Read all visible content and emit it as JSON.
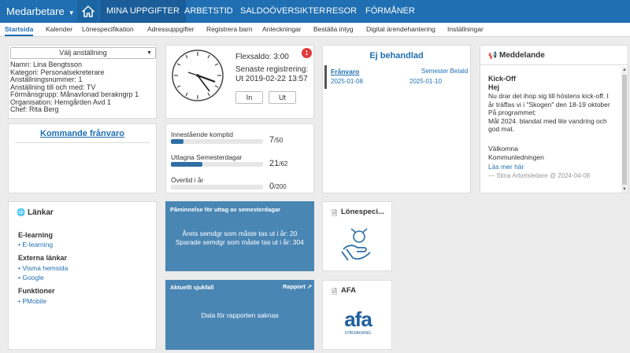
{
  "topbar": {
    "brand": "Medarbetare",
    "nav": [
      "MINA UPPGIFTER",
      "ARBETSTID",
      "SALDOÖVERSIKTER",
      "RESOR",
      "FÖRMÅNER"
    ]
  },
  "subnav": [
    "Startsida",
    "Kalender",
    "Lönespecifikation",
    "Adressuppgifter",
    "Registrera barn",
    "Anteckningar",
    "Beställa intyg",
    "Digital ärendehantering",
    "Inställningar"
  ],
  "employee": {
    "select_label": "Välj anställning",
    "lines": [
      "Namn: Lina Bengtsson",
      "Kategori: Personalsekreterare",
      "Anställningsnummer: 1",
      "Anställning till och med: TV",
      "Förmånsgrupp: Månavlonad berakngrp 1",
      "Organisation: Hemgården Avd 1",
      "Chef: Rita Berg"
    ]
  },
  "clock": {
    "flex": "Flexsaldo: 3:00",
    "last_label": "Senaste registrering:",
    "last_value": "Ut 2019-02-22 13:57",
    "badge": "1",
    "in_label": "In",
    "out_label": "Ut"
  },
  "pending": {
    "title": "Ej behandlad",
    "type": "Frånvaro",
    "status": "Semester Betald",
    "date1": "2025-01-08",
    "date2": "2025-01-10"
  },
  "message": {
    "title": "Meddelande",
    "subject": "Kick-Off",
    "greeting": "Hej",
    "lines": [
      "Nu drar det ihop sig till höstens kick-off. I",
      "år träffas vi i \"Skogen\" den 18-19 oktober",
      "På programmet:",
      "Mål 2024. blandat med lite vandring och",
      "god mat."
    ],
    "signoff1": "Välkomna",
    "signoff2": "Kommunledningen",
    "read_more": "Läs mer här",
    "footer": "— Stina Arbetsledare @ 2024-04-08"
  },
  "absence": {
    "title": "Kommande frånvaro"
  },
  "balances": [
    {
      "label": "Innestående komptid",
      "value": "7",
      "total": "/50",
      "fraction": 0.14
    },
    {
      "label": "Uttagna Semesterdagar",
      "value": "21",
      "total": "/62",
      "fraction": 0.34
    },
    {
      "label": "Övertid i år",
      "value": "0",
      "total": "/200",
      "fraction": 0
    }
  ],
  "links": {
    "title": "Länkar",
    "groups": [
      {
        "heading": "E-learning",
        "items": [
          "E-learning"
        ]
      },
      {
        "heading": "Externa länkar",
        "items": [
          "Visma hemsida",
          "Google"
        ]
      },
      {
        "heading": "Funktioner",
        "items": [
          "PMobile"
        ]
      }
    ]
  },
  "vacation": {
    "title": "Påminnelse för uttag av semesterdagar",
    "line1": "Årets semdgr som måste tas ut i år: 20",
    "line2": "Sparade semdgr som måste tas ut i år: 304"
  },
  "sick": {
    "title": "Aktuellt sjukfall",
    "report": "Rapport",
    "body": "Data för rapporten saknas"
  },
  "payslip": {
    "title": "Lönespeci..."
  },
  "afa": {
    "title": "AFA",
    "logo": "afa",
    "logo_sub": "FÖRSÄKRING"
  },
  "colors": {
    "primary": "#1f6fb2",
    "tile": "#4a86b4",
    "badge": "#e03a3a"
  }
}
